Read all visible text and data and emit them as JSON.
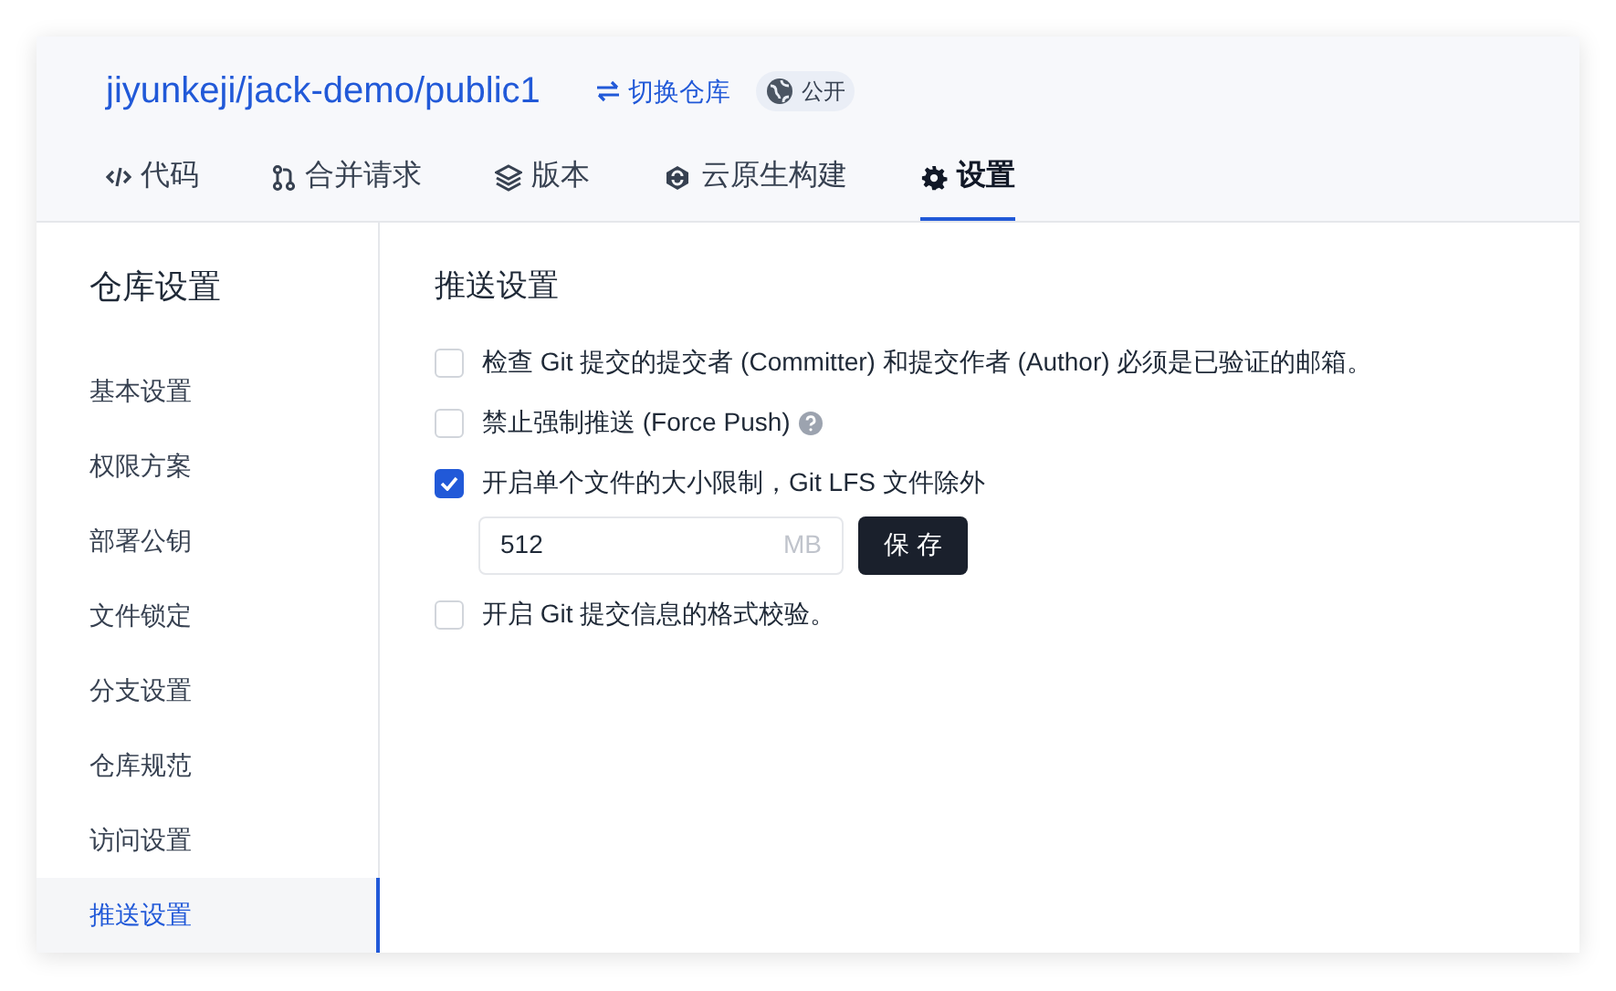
{
  "repo": {
    "path": "jiyunkeji/jack-demo/public1",
    "switch_link": "切换仓库",
    "visibility": "公开"
  },
  "tabs": [
    {
      "label": "代码",
      "selected": false
    },
    {
      "label": "合并请求",
      "selected": false
    },
    {
      "label": "版本",
      "selected": false
    },
    {
      "label": "云原生构建",
      "selected": false
    },
    {
      "label": "设置",
      "selected": true
    }
  ],
  "sidebar": {
    "title": "仓库设置",
    "items": [
      {
        "label": "基本设置",
        "selected": false
      },
      {
        "label": "权限方案",
        "selected": false
      },
      {
        "label": "部署公钥",
        "selected": false
      },
      {
        "label": "文件锁定",
        "selected": false
      },
      {
        "label": "分支设置",
        "selected": false
      },
      {
        "label": "仓库规范",
        "selected": false
      },
      {
        "label": "访问设置",
        "selected": false
      },
      {
        "label": "推送设置",
        "selected": true
      }
    ]
  },
  "section": {
    "title": "推送设置",
    "options": [
      {
        "label": "检查 Git 提交的提交者 (Committer) 和提交作者 (Author) 必须是已验证的邮箱。",
        "checked": false
      },
      {
        "label": "禁止强制推送 (Force Push)",
        "checked": false,
        "help": true
      },
      {
        "label": "开启单个文件的大小限制，Git LFS 文件除外",
        "checked": true,
        "size_input": {
          "value": "512",
          "unit": "MB"
        },
        "save_button": "保 存"
      },
      {
        "label": "开启 Git 提交信息的格式校验。",
        "checked": false
      }
    ]
  }
}
